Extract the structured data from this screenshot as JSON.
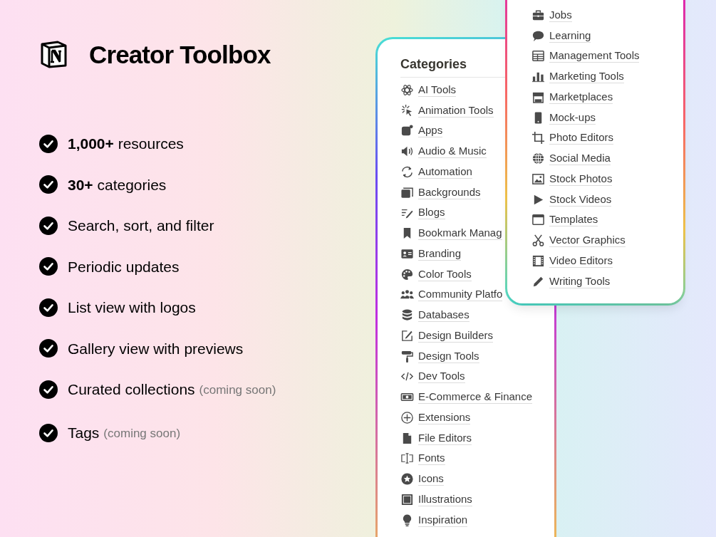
{
  "title": "Creator Toolbox",
  "features": [
    {
      "text": "**1,000+** resources"
    },
    {
      "text": "**30+** categories"
    },
    {
      "text": "Search, sort, and filter"
    },
    {
      "text": "Periodic updates"
    },
    {
      "text": "List view with logos"
    },
    {
      "text": "Gallery view with previews"
    },
    {
      "text": "Curated collections",
      "note": "(coming soon)"
    },
    {
      "text": "Tags",
      "note": "(coming soon)"
    }
  ],
  "categories_card": {
    "heading": "Categories",
    "items": [
      "AI Tools",
      "Animation Tools",
      "Apps",
      "Audio & Music",
      "Automation",
      "Backgrounds",
      "Blogs",
      "Bookmark Manag",
      "Branding",
      "Color Tools",
      "Community Platfo",
      "Databases",
      "Design Builders",
      "Design Tools",
      "Dev Tools",
      "E-Commerce & Finance",
      "Extensions",
      "File Editors",
      "Fonts",
      "Icons",
      "Illustrations",
      "Inspiration"
    ]
  },
  "second_card": {
    "items": [
      "Jobs",
      "Learning",
      "Management Tools",
      "Marketing Tools",
      "Marketplaces",
      "Mock-ups",
      "Photo Editors",
      "Social Media",
      "Stock Photos",
      "Stock Videos",
      "Templates",
      "Vector Graphics",
      "Video Editors",
      "Writing Tools"
    ]
  }
}
